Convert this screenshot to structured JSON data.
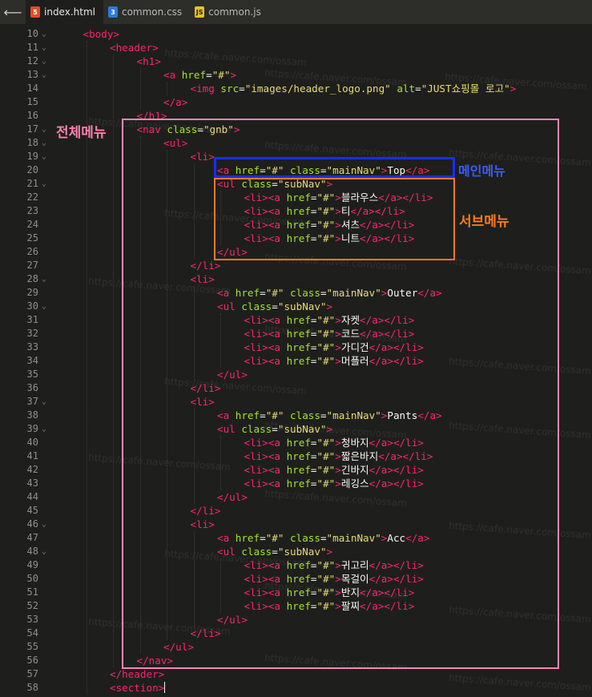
{
  "tabs": [
    {
      "label": "index.html",
      "icon": "html5-icon",
      "type": "html",
      "active": true
    },
    {
      "label": "common.css",
      "icon": "css3-icon",
      "type": "css",
      "active": false
    },
    {
      "label": "common.js",
      "icon": "js-icon",
      "type": "js",
      "active": false
    }
  ],
  "annotations": {
    "all_menu": "전체메뉴",
    "main_menu": "메인메뉴",
    "sub_menu": "서브메뉴"
  },
  "colors": {
    "tag": "#f92672",
    "attr": "#a6e22e",
    "string": "#e6db74",
    "text": "#f8f8f2",
    "pink_box": "#ff85b4",
    "blue_box": "#1a2bff",
    "orange_box": "#ef7a1a"
  },
  "code_lines": [
    {
      "n": "10",
      "i": 1,
      "f": true,
      "tokens": [
        [
          "t",
          "<body>"
        ]
      ]
    },
    {
      "n": "11",
      "i": 2,
      "f": true,
      "tokens": [
        [
          "t",
          "<header>"
        ]
      ]
    },
    {
      "n": "12",
      "i": 3,
      "f": true,
      "tokens": [
        [
          "t",
          "<h1>"
        ]
      ]
    },
    {
      "n": "13",
      "i": 4,
      "f": true,
      "tokens": [
        [
          "t",
          "<a "
        ],
        [
          "a",
          "href"
        ],
        [
          "x",
          "="
        ],
        [
          "s",
          "\"#\""
        ],
        [
          "t",
          ">"
        ]
      ]
    },
    {
      "n": "14",
      "i": 5,
      "f": false,
      "tokens": [
        [
          "t",
          "<img "
        ],
        [
          "a",
          "src"
        ],
        [
          "x",
          "="
        ],
        [
          "s",
          "\"images/header_logo.png\""
        ],
        [
          "x",
          " "
        ],
        [
          "a",
          "alt"
        ],
        [
          "x",
          "="
        ],
        [
          "s",
          "\"JUST쇼핑몰 로고\""
        ],
        [
          "t",
          ">"
        ]
      ]
    },
    {
      "n": "15",
      "i": 4,
      "f": false,
      "tokens": [
        [
          "t",
          "</a>"
        ]
      ]
    },
    {
      "n": "16",
      "i": 3,
      "f": false,
      "tokens": [
        [
          "t",
          "</h1>"
        ]
      ]
    },
    {
      "n": "17",
      "i": 3,
      "f": true,
      "tokens": [
        [
          "t",
          "<nav "
        ],
        [
          "a",
          "class"
        ],
        [
          "x",
          "="
        ],
        [
          "s",
          "\"gnb\""
        ],
        [
          "t",
          ">"
        ]
      ]
    },
    {
      "n": "18",
      "i": 4,
      "f": true,
      "tokens": [
        [
          "t",
          "<ul>"
        ]
      ]
    },
    {
      "n": "19",
      "i": 5,
      "f": true,
      "tokens": [
        [
          "t",
          "<li>"
        ]
      ]
    },
    {
      "n": "20",
      "i": 6,
      "f": false,
      "tokens": [
        [
          "t",
          "<a "
        ],
        [
          "a",
          "href"
        ],
        [
          "x",
          "="
        ],
        [
          "s",
          "\"#\""
        ],
        [
          "x",
          " "
        ],
        [
          "a",
          "class"
        ],
        [
          "x",
          "="
        ],
        [
          "s",
          "\"mainNav\""
        ],
        [
          "t",
          ">"
        ],
        [
          "x",
          "Top"
        ],
        [
          "t",
          "</a>"
        ]
      ]
    },
    {
      "n": "21",
      "i": 6,
      "f": true,
      "tokens": [
        [
          "t",
          "<ul "
        ],
        [
          "a",
          "class"
        ],
        [
          "x",
          "="
        ],
        [
          "s",
          "\"subNav\""
        ],
        [
          "t",
          ">"
        ]
      ]
    },
    {
      "n": "22",
      "i": 7,
      "f": false,
      "tokens": [
        [
          "t",
          "<li><a "
        ],
        [
          "a",
          "href"
        ],
        [
          "x",
          "="
        ],
        [
          "s",
          "\"#\""
        ],
        [
          "t",
          ">"
        ],
        [
          "x",
          "블라우스"
        ],
        [
          "t",
          "</a></li>"
        ]
      ]
    },
    {
      "n": "23",
      "i": 7,
      "f": false,
      "tokens": [
        [
          "t",
          "<li><a "
        ],
        [
          "a",
          "href"
        ],
        [
          "x",
          "="
        ],
        [
          "s",
          "\"#\""
        ],
        [
          "t",
          ">"
        ],
        [
          "x",
          "티"
        ],
        [
          "t",
          "</a></li>"
        ]
      ]
    },
    {
      "n": "24",
      "i": 7,
      "f": false,
      "tokens": [
        [
          "t",
          "<li><a "
        ],
        [
          "a",
          "href"
        ],
        [
          "x",
          "="
        ],
        [
          "s",
          "\"#\""
        ],
        [
          "t",
          ">"
        ],
        [
          "x",
          "셔츠"
        ],
        [
          "t",
          "</a></li>"
        ]
      ]
    },
    {
      "n": "25",
      "i": 7,
      "f": false,
      "tokens": [
        [
          "t",
          "<li><a "
        ],
        [
          "a",
          "href"
        ],
        [
          "x",
          "="
        ],
        [
          "s",
          "\"#\""
        ],
        [
          "t",
          ">"
        ],
        [
          "x",
          "니트"
        ],
        [
          "t",
          "</a></li>"
        ]
      ]
    },
    {
      "n": "26",
      "i": 6,
      "f": false,
      "tokens": [
        [
          "t",
          "</ul>"
        ]
      ]
    },
    {
      "n": "27",
      "i": 5,
      "f": false,
      "tokens": [
        [
          "t",
          "</li>"
        ]
      ]
    },
    {
      "n": "28",
      "i": 5,
      "f": true,
      "tokens": [
        [
          "t",
          "<li>"
        ]
      ]
    },
    {
      "n": "29",
      "i": 6,
      "f": false,
      "tokens": [
        [
          "t",
          "<a "
        ],
        [
          "a",
          "href"
        ],
        [
          "x",
          "="
        ],
        [
          "s",
          "\"#\""
        ],
        [
          "x",
          " "
        ],
        [
          "a",
          "class"
        ],
        [
          "x",
          "="
        ],
        [
          "s",
          "\"mainNav\""
        ],
        [
          "t",
          ">"
        ],
        [
          "x",
          "Outer"
        ],
        [
          "t",
          "</a>"
        ]
      ]
    },
    {
      "n": "30",
      "i": 6,
      "f": true,
      "tokens": [
        [
          "t",
          "<ul "
        ],
        [
          "a",
          "class"
        ],
        [
          "x",
          "="
        ],
        [
          "s",
          "\"subNav\""
        ],
        [
          "t",
          ">"
        ]
      ]
    },
    {
      "n": "31",
      "i": 7,
      "f": false,
      "tokens": [
        [
          "t",
          "<li><a "
        ],
        [
          "a",
          "href"
        ],
        [
          "x",
          "="
        ],
        [
          "s",
          "\"#\""
        ],
        [
          "t",
          ">"
        ],
        [
          "x",
          "자켓"
        ],
        [
          "t",
          "</a></li>"
        ]
      ]
    },
    {
      "n": "32",
      "i": 7,
      "f": false,
      "tokens": [
        [
          "t",
          "<li><a "
        ],
        [
          "a",
          "href"
        ],
        [
          "x",
          "="
        ],
        [
          "s",
          "\"#\""
        ],
        [
          "t",
          ">"
        ],
        [
          "x",
          "코드"
        ],
        [
          "t",
          "</a></li>"
        ]
      ]
    },
    {
      "n": "33",
      "i": 7,
      "f": false,
      "tokens": [
        [
          "t",
          "<li><a "
        ],
        [
          "a",
          "href"
        ],
        [
          "x",
          "="
        ],
        [
          "s",
          "\"#\""
        ],
        [
          "t",
          ">"
        ],
        [
          "x",
          "가디건"
        ],
        [
          "t",
          "</a></li>"
        ]
      ]
    },
    {
      "n": "34",
      "i": 7,
      "f": false,
      "tokens": [
        [
          "t",
          "<li><a "
        ],
        [
          "a",
          "href"
        ],
        [
          "x",
          "="
        ],
        [
          "s",
          "\"#\""
        ],
        [
          "t",
          ">"
        ],
        [
          "x",
          "머플러"
        ],
        [
          "t",
          "</a></li>"
        ]
      ]
    },
    {
      "n": "35",
      "i": 6,
      "f": false,
      "tokens": [
        [
          "t",
          "</ul>"
        ]
      ]
    },
    {
      "n": "36",
      "i": 5,
      "f": false,
      "tokens": [
        [
          "t",
          "</li>"
        ]
      ]
    },
    {
      "n": "37",
      "i": 5,
      "f": true,
      "tokens": [
        [
          "t",
          "<li>"
        ]
      ]
    },
    {
      "n": "38",
      "i": 6,
      "f": false,
      "tokens": [
        [
          "t",
          "<a "
        ],
        [
          "a",
          "href"
        ],
        [
          "x",
          "="
        ],
        [
          "s",
          "\"#\""
        ],
        [
          "x",
          " "
        ],
        [
          "a",
          "class"
        ],
        [
          "x",
          "="
        ],
        [
          "s",
          "\"mainNav\""
        ],
        [
          "t",
          ">"
        ],
        [
          "x",
          "Pants"
        ],
        [
          "t",
          "</a>"
        ]
      ]
    },
    {
      "n": "39",
      "i": 6,
      "f": true,
      "tokens": [
        [
          "t",
          "<ul "
        ],
        [
          "a",
          "class"
        ],
        [
          "x",
          "="
        ],
        [
          "s",
          "\"subNav\""
        ],
        [
          "t",
          ">"
        ]
      ]
    },
    {
      "n": "40",
      "i": 7,
      "f": false,
      "tokens": [
        [
          "t",
          "<li><a "
        ],
        [
          "a",
          "href"
        ],
        [
          "x",
          "="
        ],
        [
          "s",
          "\"#\""
        ],
        [
          "t",
          ">"
        ],
        [
          "x",
          "청바지"
        ],
        [
          "t",
          "</a></li>"
        ]
      ]
    },
    {
      "n": "41",
      "i": 7,
      "f": false,
      "tokens": [
        [
          "t",
          "<li><a "
        ],
        [
          "a",
          "href"
        ],
        [
          "x",
          "="
        ],
        [
          "s",
          "\"#\""
        ],
        [
          "t",
          ">"
        ],
        [
          "x",
          "짧은바지"
        ],
        [
          "t",
          "</a></li>"
        ]
      ]
    },
    {
      "n": "42",
      "i": 7,
      "f": false,
      "tokens": [
        [
          "t",
          "<li><a "
        ],
        [
          "a",
          "href"
        ],
        [
          "x",
          "="
        ],
        [
          "s",
          "\"#\""
        ],
        [
          "t",
          ">"
        ],
        [
          "x",
          "긴바지"
        ],
        [
          "t",
          "</a></li>"
        ]
      ]
    },
    {
      "n": "43",
      "i": 7,
      "f": false,
      "tokens": [
        [
          "t",
          "<li><a "
        ],
        [
          "a",
          "href"
        ],
        [
          "x",
          "="
        ],
        [
          "s",
          "\"#\""
        ],
        [
          "t",
          ">"
        ],
        [
          "x",
          "레깅스"
        ],
        [
          "t",
          "</a></li>"
        ]
      ]
    },
    {
      "n": "44",
      "i": 6,
      "f": false,
      "tokens": [
        [
          "t",
          "</ul>"
        ]
      ]
    },
    {
      "n": "45",
      "i": 5,
      "f": false,
      "tokens": [
        [
          "t",
          "</li>"
        ]
      ]
    },
    {
      "n": "46",
      "i": 5,
      "f": true,
      "tokens": [
        [
          "t",
          "<li>"
        ]
      ]
    },
    {
      "n": "47",
      "i": 6,
      "f": false,
      "tokens": [
        [
          "t",
          "<a "
        ],
        [
          "a",
          "href"
        ],
        [
          "x",
          "="
        ],
        [
          "s",
          "\"#\""
        ],
        [
          "x",
          " "
        ],
        [
          "a",
          "class"
        ],
        [
          "x",
          "="
        ],
        [
          "s",
          "\"mainNav\""
        ],
        [
          "t",
          ">"
        ],
        [
          "x",
          "Acc"
        ],
        [
          "t",
          "</a>"
        ]
      ]
    },
    {
      "n": "48",
      "i": 6,
      "f": true,
      "tokens": [
        [
          "t",
          "<ul "
        ],
        [
          "a",
          "class"
        ],
        [
          "x",
          "="
        ],
        [
          "s",
          "\"subNav\""
        ],
        [
          "t",
          ">"
        ]
      ]
    },
    {
      "n": "49",
      "i": 7,
      "f": false,
      "tokens": [
        [
          "t",
          "<li><a "
        ],
        [
          "a",
          "href"
        ],
        [
          "x",
          "="
        ],
        [
          "s",
          "\"#\""
        ],
        [
          "t",
          ">"
        ],
        [
          "x",
          "귀고리"
        ],
        [
          "t",
          "</a></li>"
        ]
      ]
    },
    {
      "n": "50",
      "i": 7,
      "f": false,
      "tokens": [
        [
          "t",
          "<li><a "
        ],
        [
          "a",
          "href"
        ],
        [
          "x",
          "="
        ],
        [
          "s",
          "\"#\""
        ],
        [
          "t",
          ">"
        ],
        [
          "x",
          "목걸이"
        ],
        [
          "t",
          "</a></li>"
        ]
      ]
    },
    {
      "n": "51",
      "i": 7,
      "f": false,
      "tokens": [
        [
          "t",
          "<li><a "
        ],
        [
          "a",
          "href"
        ],
        [
          "x",
          "="
        ],
        [
          "s",
          "\"#\""
        ],
        [
          "t",
          ">"
        ],
        [
          "x",
          "반지"
        ],
        [
          "t",
          "</a></li>"
        ]
      ]
    },
    {
      "n": "52",
      "i": 7,
      "f": false,
      "tokens": [
        [
          "t",
          "<li><a "
        ],
        [
          "a",
          "href"
        ],
        [
          "x",
          "="
        ],
        [
          "s",
          "\"#\""
        ],
        [
          "t",
          ">"
        ],
        [
          "x",
          "팔찌"
        ],
        [
          "t",
          "</a></li>"
        ]
      ]
    },
    {
      "n": "53",
      "i": 6,
      "f": false,
      "tokens": [
        [
          "t",
          "</ul>"
        ]
      ]
    },
    {
      "n": "54",
      "i": 5,
      "f": false,
      "tokens": [
        [
          "t",
          "</li>"
        ]
      ]
    },
    {
      "n": "55",
      "i": 4,
      "f": false,
      "tokens": [
        [
          "t",
          "</ul>"
        ]
      ]
    },
    {
      "n": "56",
      "i": 3,
      "f": false,
      "tokens": [
        [
          "t",
          "</nav>"
        ]
      ]
    },
    {
      "n": "57",
      "i": 2,
      "f": false,
      "tokens": [
        [
          "t",
          "</header>"
        ]
      ]
    },
    {
      "n": "58",
      "i": 2,
      "f": false,
      "tokens": [
        [
          "t",
          "<section>"
        ]
      ],
      "cursor": true
    }
  ],
  "watermark": "https://cafe.naver.com/ossam"
}
